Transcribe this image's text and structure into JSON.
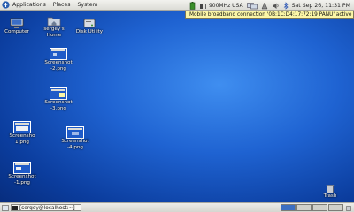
{
  "top_panel": {
    "menus": [
      "Applications",
      "Places",
      "System"
    ],
    "network_label": "900MHz USA",
    "clock": "Sat Sep 26, 11:31 PM"
  },
  "tooltip": "Mobile broadband connection '0B:1C:D4:17:72:19 PANU' active",
  "desktop": {
    "icons": [
      {
        "label": "Computer"
      },
      {
        "label": "sergey's Home"
      },
      {
        "label": "Disk Utility"
      },
      {
        "label": "Screenshot -2.png"
      },
      {
        "label": "Screenshot -3.png"
      },
      {
        "label": "Screensho 1.png"
      },
      {
        "label": "Screenshot -4.png"
      },
      {
        "label": "Screenshot -1.png"
      },
      {
        "label": "Trash"
      }
    ]
  },
  "bottom_panel": {
    "task_label": "[sergey@localhost:~]"
  },
  "colors": {
    "desktop": "#1f63d2",
    "tooltip_bg": "#fbf6a6",
    "panel": "#e6e6e1",
    "active_workspace": "#3c6fc2"
  }
}
